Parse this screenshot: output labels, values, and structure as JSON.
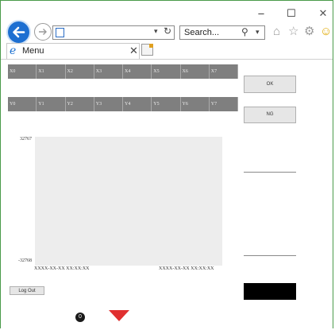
{
  "window_controls": {
    "minimize": "–",
    "maximize": "☐",
    "close": "✕"
  },
  "browser": {
    "search_placeholder": "Search...",
    "tab_title": "Menu"
  },
  "grid": {
    "row1": [
      "X0",
      "X1",
      "X2",
      "X3",
      "X4",
      "X5",
      "X6",
      "X7"
    ],
    "row2": [
      "Y0",
      "Y1",
      "Y2",
      "Y3",
      "Y4",
      "Y5",
      "Y6",
      "Y7"
    ]
  },
  "buttons": {
    "ok": "OK",
    "ng": "NG",
    "logout": "Log Out"
  },
  "chart": {
    "y_max": "32767",
    "y_min": "-32768",
    "x_start": "XXXX-XX-XX XX:XX:XX",
    "x_end": "XXXX-XX-XX XX:XX:XX"
  },
  "badge_count": "0",
  "colors": {
    "grid_cell": "#7f7f7f",
    "chart_bg": "#ededed",
    "arrow": "#e03030",
    "back_button": "#1d6fd1"
  }
}
